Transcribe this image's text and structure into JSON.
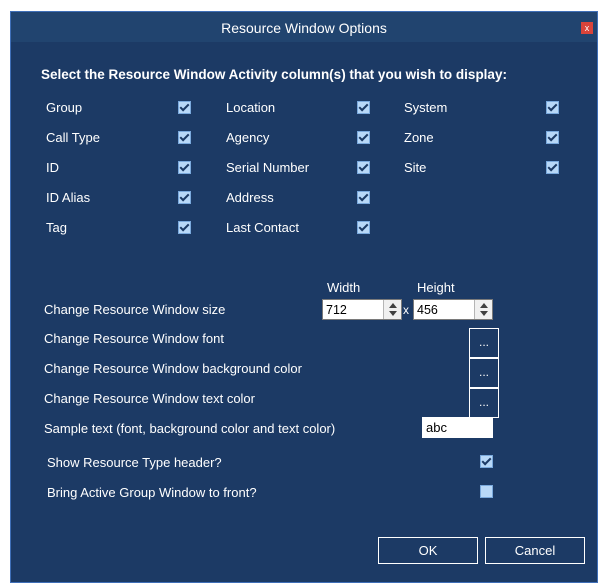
{
  "window": {
    "title": "Resource Window Options",
    "close_symbol": "x"
  },
  "heading": "Select the Resource Window Activity column(s) that you wish to display:",
  "columns": {
    "col1": [
      {
        "label": "Group",
        "checked": true
      },
      {
        "label": "Call Type",
        "checked": true
      },
      {
        "label": "ID",
        "checked": true
      },
      {
        "label": "ID Alias",
        "checked": true
      },
      {
        "label": "Tag",
        "checked": true
      }
    ],
    "col2": [
      {
        "label": "Location",
        "checked": true
      },
      {
        "label": "Agency",
        "checked": true
      },
      {
        "label": "Serial Number",
        "checked": true
      },
      {
        "label": "Address",
        "checked": true
      },
      {
        "label": "Last Contact",
        "checked": true
      }
    ],
    "col3": [
      {
        "label": "System",
        "checked": true
      },
      {
        "label": "Zone",
        "checked": true
      },
      {
        "label": "Site",
        "checked": true
      }
    ]
  },
  "size": {
    "width_label": "Width",
    "height_label": "Height",
    "row_label": "Change Resource Window size",
    "width_value": "712",
    "height_value": "456",
    "separator": "x"
  },
  "font_row": {
    "label": "Change Resource Window font",
    "button": "..."
  },
  "bg_row": {
    "label": "Change Resource Window background color",
    "button": "..."
  },
  "text_row": {
    "label": "Change Resource Window text color",
    "button": "..."
  },
  "sample": {
    "label": "Sample text (font, background color and text color)",
    "value": "abc"
  },
  "show_header": {
    "label": "Show Resource Type header?",
    "checked": true
  },
  "bring_front": {
    "label": "Bring Active Group Window to front?",
    "checked": false
  },
  "buttons": {
    "ok": "OK",
    "cancel": "Cancel"
  }
}
